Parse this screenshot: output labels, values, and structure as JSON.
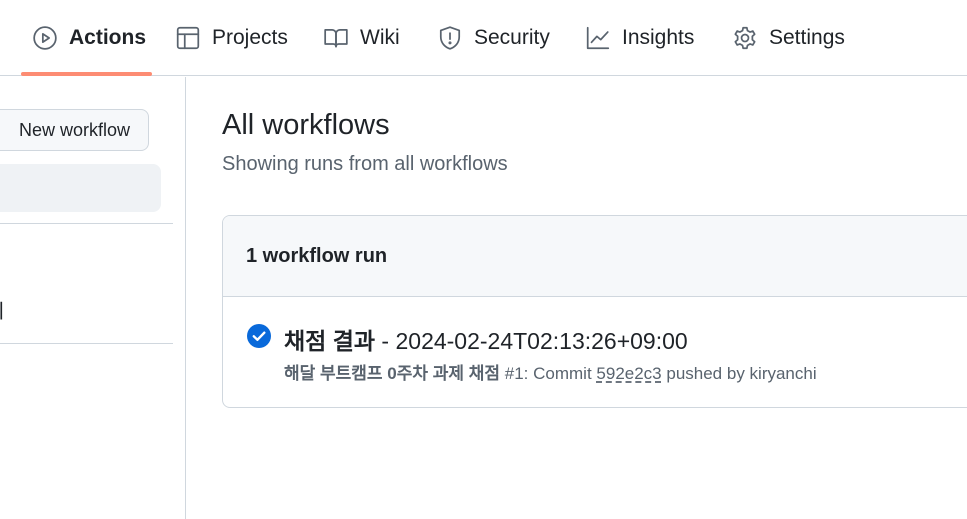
{
  "nav": {
    "tabs": [
      {
        "label": "Actions",
        "icon": "play-icon",
        "active": true
      },
      {
        "label": "Projects",
        "icon": "table-icon"
      },
      {
        "label": "Wiki",
        "icon": "book-icon"
      },
      {
        "label": "Security",
        "icon": "shield-icon"
      },
      {
        "label": "Insights",
        "icon": "graph-icon"
      },
      {
        "label": "Settings",
        "icon": "gear-icon"
      }
    ],
    "active_underline_color": "#fd8c73"
  },
  "sidebar": {
    "new_workflow_label": "New workflow",
    "cut_item_fragment": "ㅣ"
  },
  "main": {
    "title": "All workflows",
    "subtitle": "Showing runs from all workflows",
    "runs_count_label": "1 workflow run",
    "runs": [
      {
        "status": "success",
        "status_color": "#0969da",
        "name": "채점 결과",
        "separator": " - ",
        "timestamp": "2024-02-24T02:13:26+09:00",
        "workflow_name": "해달 부트캠프 0주차 과제 채점",
        "run_number": "#1: Commit ",
        "commit_sha": "592e2c3",
        "pushed_by": " pushed by kiryanchi"
      }
    ]
  }
}
